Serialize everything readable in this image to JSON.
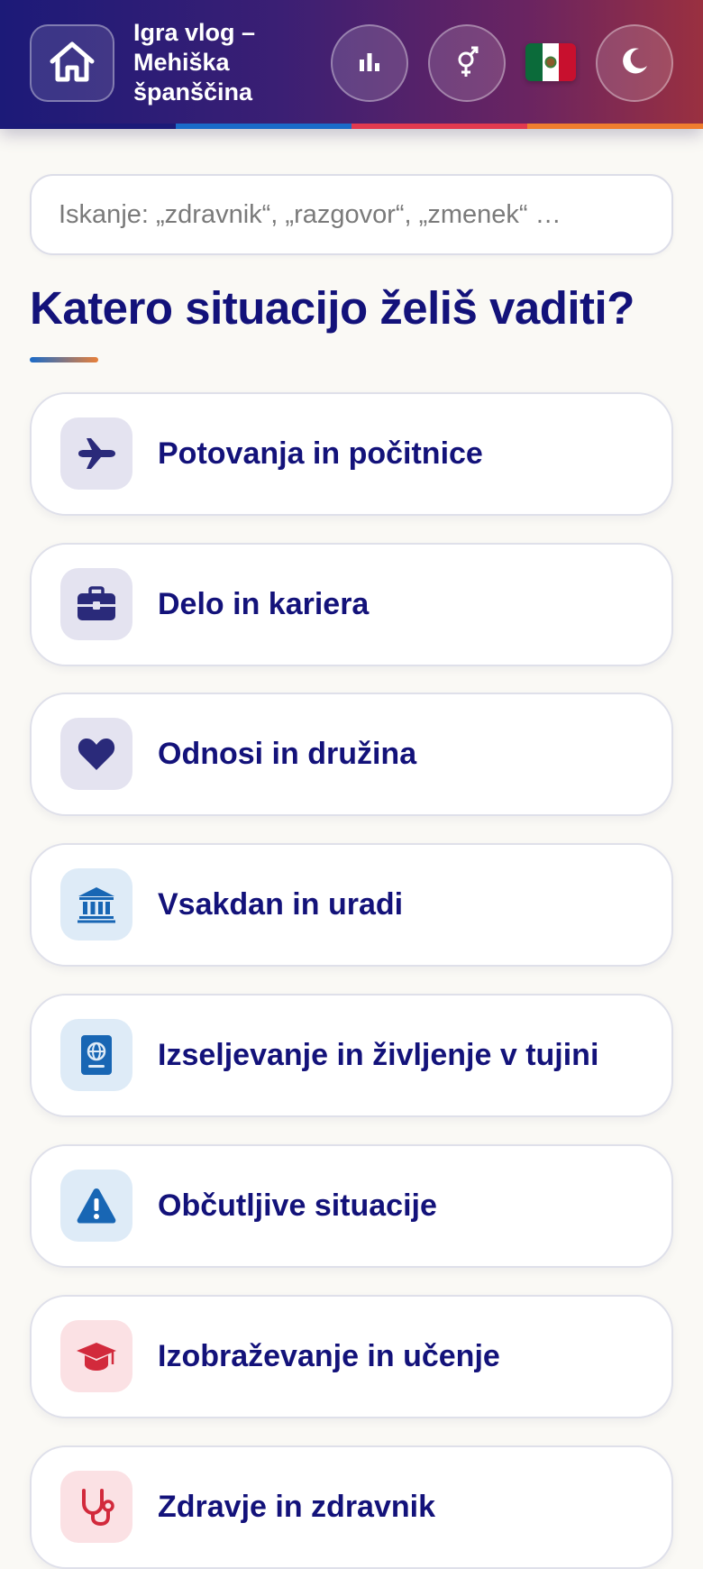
{
  "header": {
    "home_icon": "home-icon",
    "title": "Igra vlog – Mehiška španščina",
    "stats_icon": "bar-chart-icon",
    "gender_icon": "gender-icon",
    "flag_icon": "mexico-flag-icon",
    "theme_icon": "moon-icon",
    "stripe_colors": [
      "#1c1a78",
      "#1a6bc9",
      "#e23a4f",
      "#ef7d2f"
    ]
  },
  "search": {
    "placeholder": "Iskanje: „zdravnik“, „razgovor“, „zmenek“ …"
  },
  "main": {
    "heading": "Katero situacijo želiš vaditi?",
    "categories": [
      {
        "label": "Potovanja in počitnice",
        "icon": "airplane-icon",
        "icon_color": "#2a2a7a",
        "icon_bg": "#e4e3f0"
      },
      {
        "label": "Delo in kariera",
        "icon": "briefcase-icon",
        "icon_color": "#2a2a7a",
        "icon_bg": "#e4e3f0"
      },
      {
        "label": "Odnosi in družina",
        "icon": "heart-icon",
        "icon_color": "#2a2a7a",
        "icon_bg": "#e4e3f0"
      },
      {
        "label": "Vsakdan in uradi",
        "icon": "bank-building-icon",
        "icon_color": "#1866b4",
        "icon_bg": "#deebf7"
      },
      {
        "label": "Izseljevanje in življenje v tujini",
        "icon": "passport-icon",
        "icon_color": "#1866b4",
        "icon_bg": "#deebf7"
      },
      {
        "label": "Občutljive situacije",
        "icon": "warning-icon",
        "icon_color": "#1866b4",
        "icon_bg": "#deebf7"
      },
      {
        "label": "Izobraževanje in učenje",
        "icon": "graduation-cap-icon",
        "icon_color": "#d22a3c",
        "icon_bg": "#fbe1e4"
      },
      {
        "label": "Zdravje in zdravnik",
        "icon": "stethoscope-icon",
        "icon_color": "#d22a3c",
        "icon_bg": "#fbe1e4"
      }
    ]
  }
}
